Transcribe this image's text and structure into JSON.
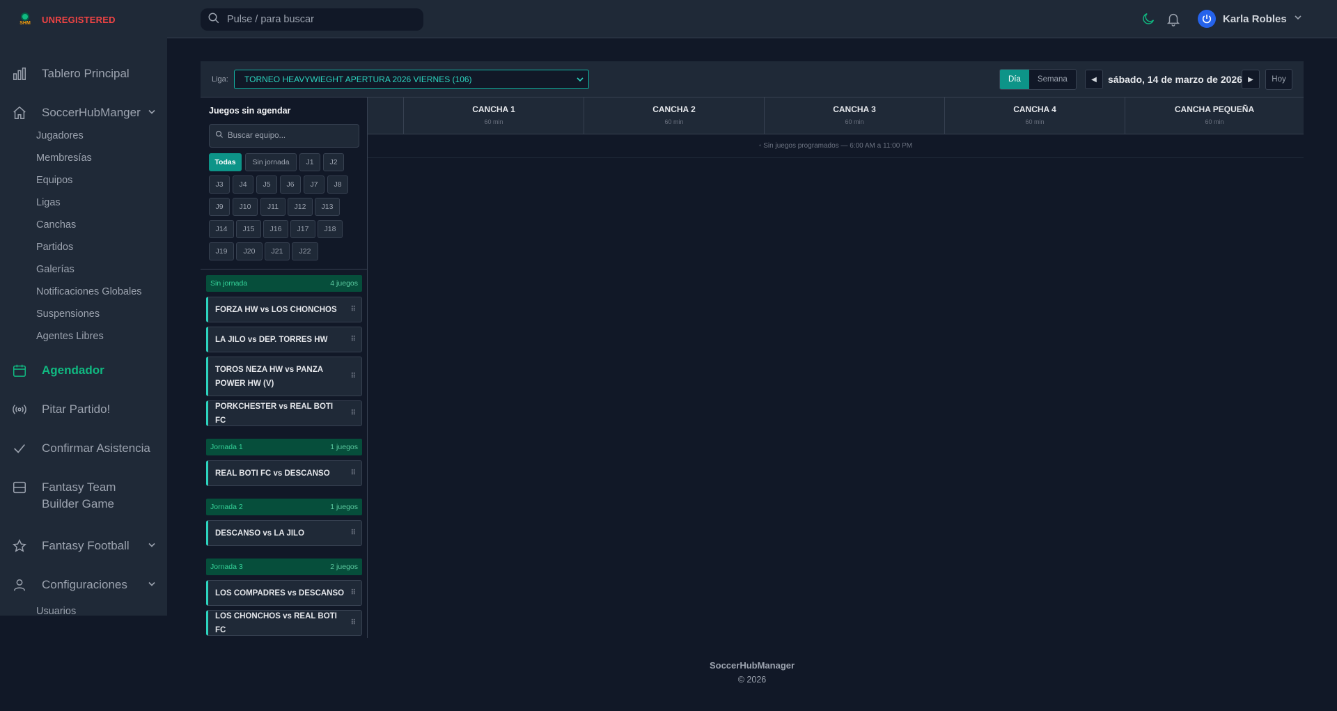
{
  "brand": {
    "logo_text": "SHM",
    "status": "UNREGISTERED"
  },
  "header": {
    "search_placeholder": "Pulse / para buscar",
    "user_name": "Karla Robles",
    "icons": [
      "moon-icon",
      "bell-icon",
      "chevron-down-icon"
    ]
  },
  "sidebar": {
    "items": [
      {
        "label": "Tablero Principal",
        "icon": "chart-icon"
      },
      {
        "label": "SoccerHubManger",
        "icon": "home-icon",
        "expandable": true,
        "children": [
          "Jugadores",
          "Membresías",
          "Equipos",
          "Ligas",
          "Canchas",
          "Partidos",
          "Galerías",
          "Notificaciones Globales",
          "Suspensiones",
          "Agentes Libres"
        ]
      },
      {
        "label": "Agendador",
        "icon": "calendar-icon",
        "active": true
      },
      {
        "label": "Pitar Partido!",
        "icon": "broadcast-icon"
      },
      {
        "label": "Confirmar Asistencia",
        "icon": "check-icon"
      },
      {
        "label": "Fantasy Team Builder Game",
        "icon": "card-icon"
      },
      {
        "label": "Fantasy Football",
        "icon": "star-icon",
        "expandable": true
      },
      {
        "label": "Configuraciones",
        "icon": "user-icon",
        "expandable": true,
        "children": [
          "Usuarios"
        ]
      }
    ]
  },
  "scheduler": {
    "liga_label": "Liga:",
    "liga_value": "TORNEO HEAVYWIEGHT APERTURA 2026 VIERNES (106)",
    "view_day": "Día",
    "view_week": "Semana",
    "date": "sábado, 14 de marzo de 2026",
    "today": "Hoy",
    "prev": "◀",
    "next": "▶",
    "unscheduled_title": "Juegos sin agendar",
    "team_search_placeholder": "Buscar equipo...",
    "filters": [
      "Todas",
      "Sin jornada",
      "J1",
      "J2",
      "J3",
      "J4",
      "J5",
      "J6",
      "J7",
      "J8",
      "J9",
      "J10",
      "J11",
      "J12",
      "J13",
      "J14",
      "J15",
      "J16",
      "J17",
      "J18",
      "J19",
      "J20",
      "J21",
      "J22"
    ],
    "groups": [
      {
        "name": "Sin jornada",
        "count": "4 juegos",
        "games": [
          "FORZA HW vs LOS CHONCHOS",
          "LA JILO vs DEP. TORRES HW",
          "TOROS NEZA HW vs PANZA POWER HW (V)",
          "PORKCHESTER vs REAL BOTI FC"
        ]
      },
      {
        "name": "Jornada 1",
        "count": "1 juegos",
        "games": [
          "REAL BOTI FC vs DESCANSO"
        ]
      },
      {
        "name": "Jornada 2",
        "count": "1 juegos",
        "games": [
          "DESCANSO vs LA JILO"
        ]
      },
      {
        "name": "Jornada 3",
        "count": "2 juegos",
        "games": [
          "LOS COMPADRES vs DESCANSO",
          "LOS CHONCHOS vs REAL BOTI FC"
        ]
      }
    ],
    "courts": [
      {
        "name": "CANCHA 1",
        "duration": "60 min"
      },
      {
        "name": "CANCHA 2",
        "duration": "60 min"
      },
      {
        "name": "CANCHA 3",
        "duration": "60 min"
      },
      {
        "name": "CANCHA 4",
        "duration": "60 min"
      },
      {
        "name": "CANCHA PEQUEÑA",
        "duration": "60 min"
      }
    ],
    "no_games_text": "◦ Sin juegos programados — 6:00 AM a 11:00 PM"
  },
  "footer": {
    "app": "SoccerHubManager",
    "copyright": "© 2026"
  },
  "colors": {
    "accent": "#0d9488",
    "active_nav": "#10b981",
    "brand_status": "#ef4444",
    "background": "#111827",
    "panel": "#1f2937"
  }
}
